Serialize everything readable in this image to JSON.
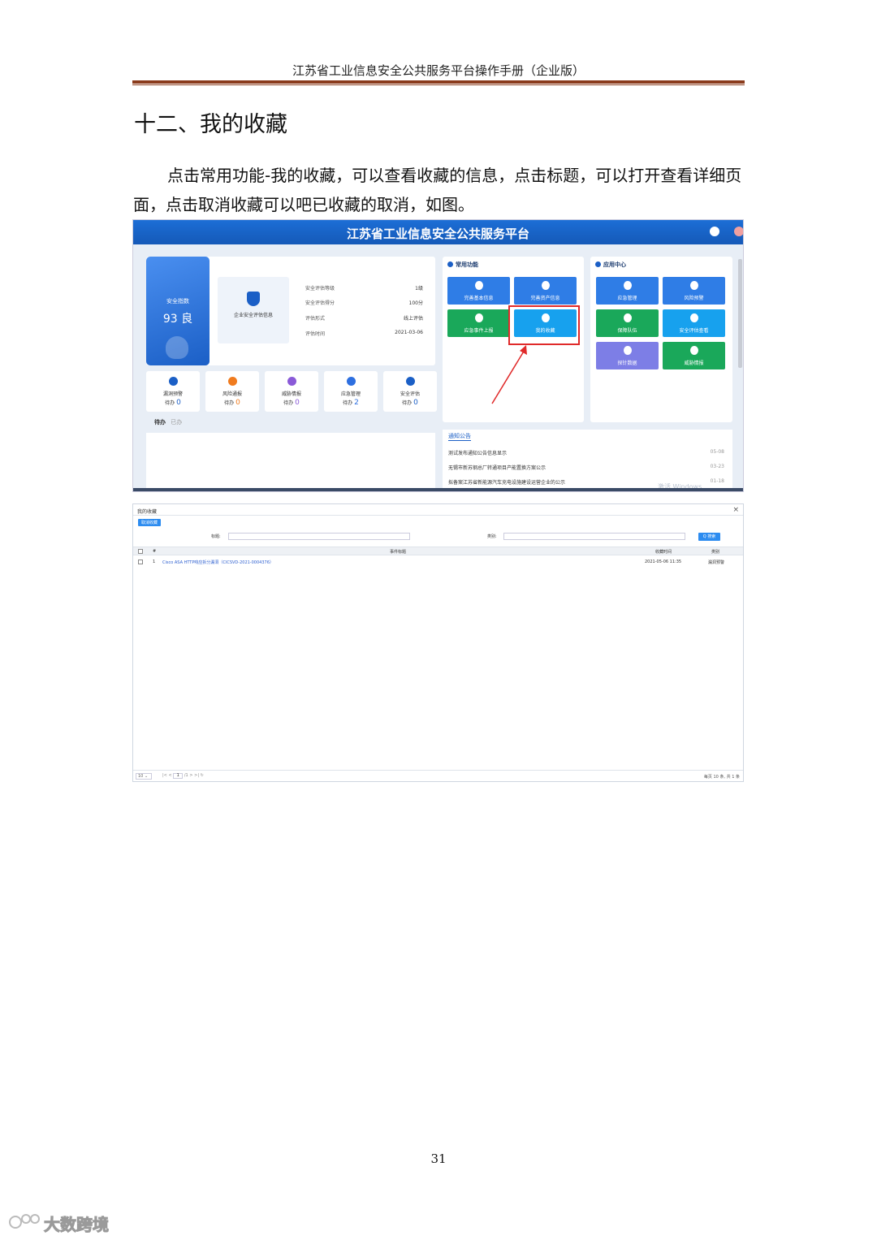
{
  "header": {
    "title": "江苏省工业信息安全公共服务平台操作手册（企业版）"
  },
  "section": {
    "title": "十二、我的收藏",
    "paragraph": "点击常用功能-我的收藏，可以查看收藏的信息，点击标题，可以打开查看详细页面，点击取消收藏可以吧已收藏的取消，如图。"
  },
  "screenshot1": {
    "app_title": "江苏省工业信息安全公共服务平台",
    "score": {
      "label": "安全指数",
      "value": "93 良"
    },
    "eval_box_label": "企业安全评估信息",
    "eval_info": [
      {
        "key": "安全评估等级",
        "value": "1级"
      },
      {
        "key": "安全评估得分",
        "value": "100分"
      },
      {
        "key": "评估形式",
        "value": "线上评估"
      },
      {
        "key": "评估时间",
        "value": "2021-03-06"
      }
    ],
    "todo_tiles": [
      {
        "name": "漏洞预警",
        "prefix": "待办",
        "count": "0",
        "color": "#1b5fc6",
        "icon": "bug-icon"
      },
      {
        "name": "风险通报",
        "prefix": "待办",
        "count": "0",
        "color": "#f07b1e",
        "icon": "bell-icon"
      },
      {
        "name": "威胁情报",
        "prefix": "待办",
        "count": "0",
        "color": "#8a5ad8",
        "icon": "alert-icon"
      },
      {
        "name": "应急管理",
        "prefix": "待办",
        "count": "2",
        "color": "#2d6fe0",
        "icon": "robot-icon"
      },
      {
        "name": "安全评估",
        "prefix": "待办",
        "count": "0",
        "color": "#1b5fc6",
        "icon": "bug-icon"
      }
    ],
    "tabs": [
      "待办",
      "已办"
    ],
    "common_functions": {
      "title": "常用功能",
      "items": [
        {
          "label": "完善基本信息",
          "color": "#2f7de6"
        },
        {
          "label": "完善资产信息",
          "color": "#2f7de6"
        },
        {
          "label": "应急事件上报",
          "color": "#1aa85a"
        },
        {
          "label": "我的收藏",
          "color": "#17a1ee"
        }
      ]
    },
    "app_center": {
      "title": "应用中心",
      "items": [
        {
          "label": "应急管理",
          "color": "#2f7de6"
        },
        {
          "label": "风险预警",
          "color": "#2f7de6"
        },
        {
          "label": "保障队伍",
          "color": "#1aa85a"
        },
        {
          "label": "安全评估查看",
          "color": "#17a1ee"
        },
        {
          "label": "探针数据",
          "color": "#7d7ee6"
        },
        {
          "label": "威胁情报",
          "color": "#1aa85a"
        }
      ]
    },
    "notices": {
      "title": "通知公告",
      "items": [
        {
          "text": "测试发布通知公告信息显示",
          "date": "05-08"
        },
        {
          "text": "无锡市新苏钢总厂转通项目产能置换方案公示",
          "date": "03-23"
        },
        {
          "text": "拟备案江苏省新能源汽车充电设施建设运营企业的公示",
          "date": "01-18"
        }
      ]
    },
    "watermark": "激活 Windows"
  },
  "screenshot2": {
    "title": "我的收藏",
    "close": "×",
    "cancel_button": "取消收藏",
    "filters": {
      "title_label": "标题:",
      "type_label": "类别:",
      "search_button": "Q 搜索"
    },
    "columns": [
      "#",
      "事件标题",
      "收藏时间",
      "类别"
    ],
    "rows": [
      {
        "index": "1",
        "title": "Cisco ASA HTTP响应拆分漏洞（CICSVD-2021-0004376）",
        "time": "2021-05-06 11:35",
        "type": "漏洞预警"
      }
    ],
    "footer": {
      "page_size": "10",
      "page_current": "1",
      "page_total": "/1",
      "summary": "每页 10 条, 共 1 条"
    }
  },
  "page_number": "31",
  "brand": "大数跨境"
}
